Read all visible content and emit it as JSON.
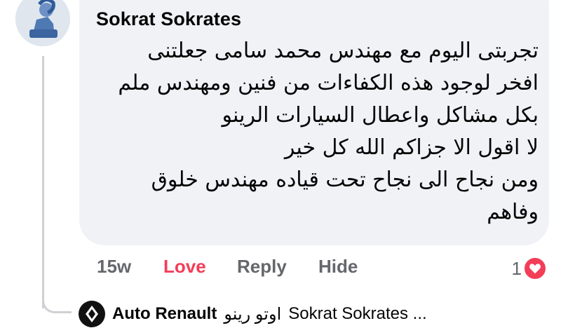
{
  "comment": {
    "author": "Sokrat Sokrates",
    "lines": [
      "تجربتى اليوم مع مهندس محمد سامى جعلتنى",
      "افخر لوجود هذه الكفاءات من فنين ومهندس ملم",
      "بكل مشاكل واعطال السيارات الرينو",
      "لا اقول الا جزاكم الله كل خير",
      "ومن نجاح الى نجاح تحت قياده مهندس خلوق",
      "وفاهم"
    ]
  },
  "actions": {
    "time": "15w",
    "love": "Love",
    "reply": "Reply",
    "hide": "Hide"
  },
  "reactions": {
    "count": "1",
    "icon": "heart-icon",
    "color": "#f33e58"
  },
  "reply_preview": {
    "name": "Auto Renault",
    "arabic_name": "اوتو رينو",
    "text": "Sokrat Sokrates ..."
  },
  "colors": {
    "bubble": "#f0f2f5",
    "muted": "#65676b",
    "love": "#f33e58"
  }
}
